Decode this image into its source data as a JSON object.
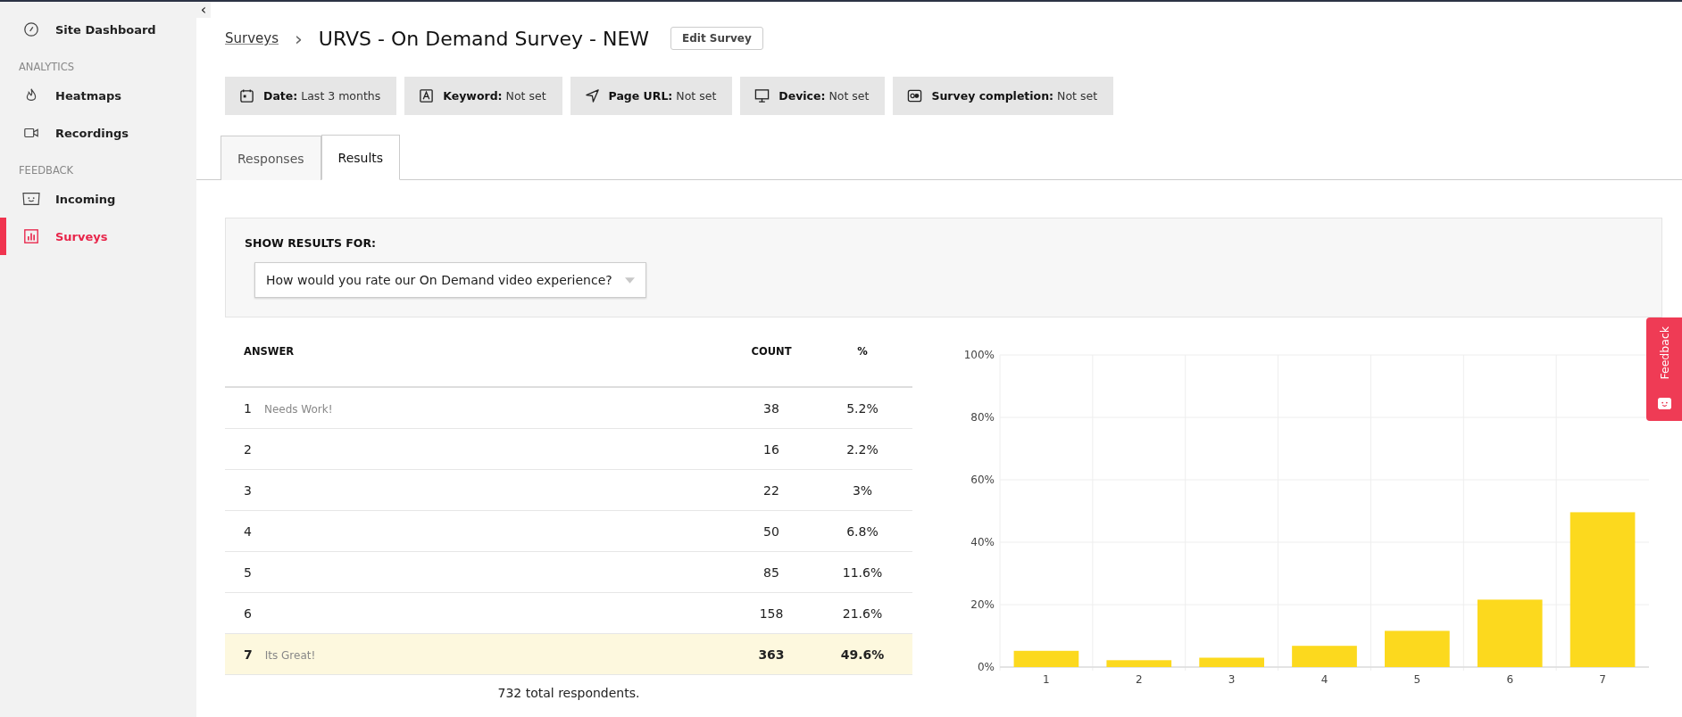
{
  "sidebar": {
    "top_items": [
      {
        "label": "Site Dashboard",
        "kind": "dashboard",
        "selected": false
      }
    ],
    "sections": [
      {
        "heading": "ANALYTICS",
        "items": [
          {
            "label": "Heatmaps",
            "kind": "heatmaps",
            "selected": false
          },
          {
            "label": "Recordings",
            "kind": "recordings",
            "selected": false
          }
        ]
      },
      {
        "heading": "FEEDBACK",
        "items": [
          {
            "label": "Incoming",
            "kind": "incoming",
            "selected": false
          },
          {
            "label": "Surveys",
            "kind": "surveys",
            "selected": true
          }
        ]
      }
    ]
  },
  "collapse_button": "‹",
  "breadcrumb": {
    "link": "Surveys",
    "separator": "›",
    "title": "URVS - On Demand Survey - NEW"
  },
  "edit_button": "Edit Survey",
  "filters": [
    {
      "kind": "date",
      "label": "Date:",
      "value": "Last 3 months"
    },
    {
      "kind": "keyword",
      "label": "Keyword:",
      "value": "Not set"
    },
    {
      "kind": "url",
      "label": "Page URL:",
      "value": "Not set"
    },
    {
      "kind": "device",
      "label": "Device:",
      "value": "Not set"
    },
    {
      "kind": "completion",
      "label": "Survey completion:",
      "value": "Not set"
    }
  ],
  "tabs": [
    {
      "label": "Responses",
      "selected": false
    },
    {
      "label": "Results",
      "selected": true
    }
  ],
  "results_for": {
    "label": "SHOW RESULTS FOR:",
    "value": "How would you rate our On Demand video experience?"
  },
  "table": {
    "columns": [
      "ANSWER",
      "COUNT",
      "%"
    ],
    "rows": [
      {
        "answer": "1",
        "note": "Needs Work!",
        "count": "38",
        "percent": "5.2%",
        "highlighted": false
      },
      {
        "answer": "2",
        "count": "16",
        "percent": "2.2%",
        "highlighted": false
      },
      {
        "answer": "3",
        "count": "22",
        "percent": "3%",
        "highlighted": false
      },
      {
        "answer": "4",
        "count": "50",
        "percent": "6.8%",
        "highlighted": false
      },
      {
        "answer": "5",
        "count": "85",
        "percent": "11.6%",
        "highlighted": false
      },
      {
        "answer": "6",
        "count": "158",
        "percent": "21.6%",
        "highlighted": false
      },
      {
        "answer": "7",
        "note": "Its Great!",
        "count": "363",
        "percent": "49.6%",
        "highlighted": true
      }
    ],
    "footer": "732 total respondents."
  },
  "chart_data": {
    "type": "bar",
    "categories": [
      "1",
      "2",
      "3",
      "4",
      "5",
      "6",
      "7"
    ],
    "grid": true,
    "series": [
      {
        "color": "#fcd91e",
        "values": [
          5.2,
          2.2,
          3,
          6.8,
          11.6,
          21.6,
          49.6
        ]
      }
    ],
    "ylim": [
      0,
      100
    ],
    "yticks": [
      {
        "value": 0,
        "label": "0%"
      },
      {
        "value": 20,
        "label": "20%"
      },
      {
        "value": 40,
        "label": "40%"
      },
      {
        "value": 60,
        "label": "60%"
      },
      {
        "value": 80,
        "label": "80%"
      },
      {
        "value": 100,
        "label": "100%"
      }
    ]
  },
  "feedback_tab": {
    "label": "Feedback"
  }
}
